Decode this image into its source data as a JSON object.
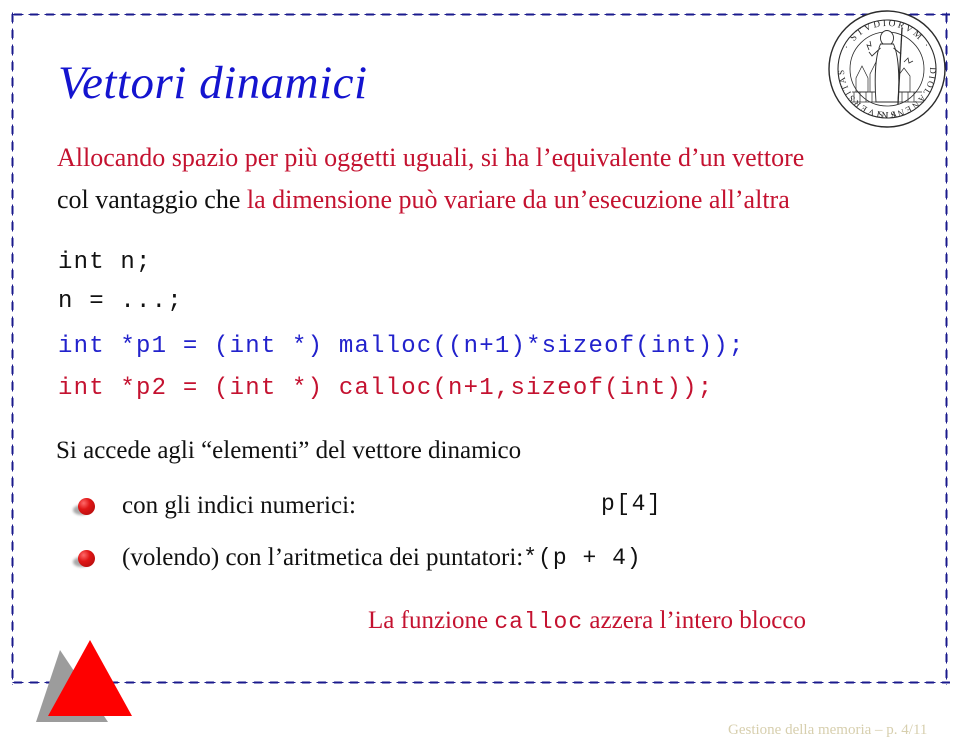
{
  "slide": {
    "title": "Vettori dinamici",
    "paragraph": {
      "line1_black": "",
      "line1_red": "Allocando spazio per più oggetti uguali, si ha l’equivalente d’un vettore",
      "line2_black": "col vantaggio che ",
      "line2_red": "la dimensione può variare da un’esecuzione all’altra"
    },
    "code_block": [
      {
        "text": "int n;",
        "color": "black"
      },
      {
        "text": "n = ...;",
        "color": "black"
      },
      {
        "text": "int *p1 = (int *) malloc((n+1)*sizeof(int));",
        "color": "blue"
      },
      {
        "text": "int *p2 = (int *) calloc(n+1,sizeof(int));",
        "color": "red"
      }
    ],
    "access_line": "Si accede agli “elementi” del vettore dinamico",
    "bullets": [
      {
        "text": "con gli indici numerici:",
        "code": "p[4]"
      },
      {
        "text": "(volendo) con l’aritmetica dei puntatori: ",
        "code": "*(p + 4)"
      }
    ],
    "closing": {
      "before": "La funzione ",
      "code": "calloc",
      "after": " azzera l’intero blocco"
    },
    "footer": "Gestione della memoria – p. 4/11",
    "seal": {
      "text_top": "STVDIORVM",
      "text_right": "MEDIOLANENSIS",
      "text_left": "VNIVERSITAS"
    },
    "colors": {
      "title_blue": "#1414cf",
      "body_red": "#c41230",
      "code_blue": "#2222cc",
      "body_black": "#111111",
      "border_dot": "#1a1a8c",
      "logo_red": "#fe0000",
      "logo_gray": "#9c9c9c",
      "footer": "#d7cfae"
    }
  }
}
